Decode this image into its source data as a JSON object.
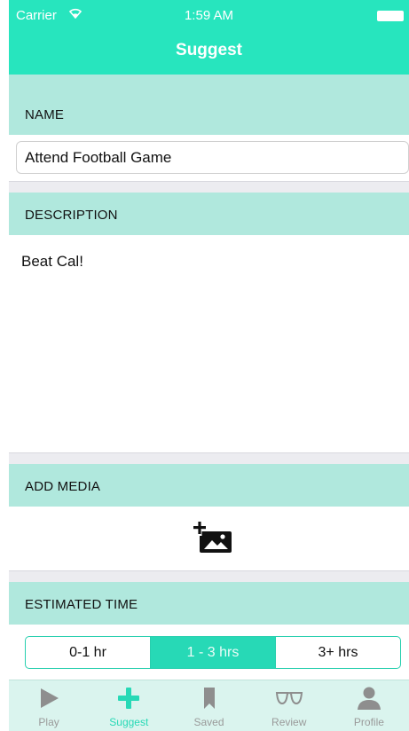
{
  "status_bar": {
    "carrier": "Carrier",
    "time": "1:59 AM"
  },
  "nav": {
    "title": "Suggest"
  },
  "sections": {
    "name_label": "NAME",
    "description_label": "DESCRIPTION",
    "media_label": "ADD MEDIA",
    "time_label": "ESTIMATED TIME"
  },
  "name": {
    "value": "Attend Football Game"
  },
  "description": {
    "value": "Beat Cal!"
  },
  "media": {
    "icon": "add-photo-icon"
  },
  "estimated_time": {
    "options": [
      "0-1 hr",
      "1 - 3 hrs",
      "3+ hrs"
    ],
    "selected_index": 1
  },
  "tabs": [
    {
      "label": "Play",
      "icon": "play-icon"
    },
    {
      "label": "Suggest",
      "icon": "plus-icon"
    },
    {
      "label": "Saved",
      "icon": "bookmark-icon"
    },
    {
      "label": "Review",
      "icon": "glasses-icon"
    },
    {
      "label": "Profile",
      "icon": "person-icon"
    }
  ],
  "colors": {
    "accent": "#27e5be",
    "section_bg": "#b0e8dd",
    "inactive": "#9a9a9a"
  }
}
